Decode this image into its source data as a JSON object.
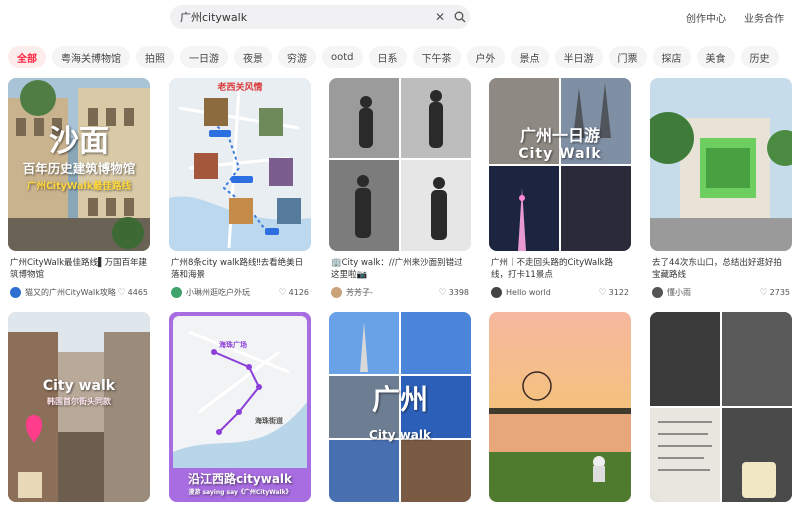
{
  "search": {
    "query": "广州citywalk"
  },
  "top_links": {
    "creator": "创作中心",
    "business": "业务合作"
  },
  "tabs": [
    "全部",
    "粤海关博物馆",
    "拍照",
    "一日游",
    "夜景",
    "穷游",
    "ootd",
    "日系",
    "下午茶",
    "户外",
    "景点",
    "半日游",
    "门票",
    "探店",
    "美食",
    "历史"
  ],
  "cards": [
    {
      "title": "广州CityWalk最佳路线▌万国百年建筑博物馆",
      "author": "猫又的广州CityWalk攻略",
      "likes": "4465",
      "cover_text": {
        "main": "沙面",
        "sub": "百年历史建筑博物馆",
        "tag": "广州CityWalk最佳路线"
      }
    },
    {
      "title": "广州8条city walk路线‼去看绝美日落和海景",
      "author": "小琳州逛吃户外玩",
      "likes": "4126",
      "cover_text": {
        "main": "老西关风情"
      }
    },
    {
      "title": "🏢City walk：//广州来沙面别错过这里啦📷",
      "author": "芳芳子-",
      "likes": "3398"
    },
    {
      "title": "广州｜不走回头路的CityWalk路线，打卡11景点",
      "author": "Hello world",
      "likes": "3122",
      "cover_text": {
        "main": "广州一日游",
        "sub": "City Walk"
      }
    },
    {
      "title": "去了44次东山口，总结出好逛好拍宝藏路线",
      "author": "懂小雨",
      "likes": "2735"
    },
    {
      "cover_text": {
        "main": "City walk",
        "sub": "韩国首尔街头同款"
      }
    },
    {
      "cover_text": {
        "main": "沿江西路citywalk",
        "sub": "海珠广场",
        "pin2": "海珠街道",
        "tag": "漫游 saying say《广州CityWalk》"
      }
    },
    {
      "cover_text": {
        "main": "广州",
        "sub": "City walk"
      }
    },
    {},
    {}
  ],
  "colors": {
    "accent": "#ff2442"
  }
}
